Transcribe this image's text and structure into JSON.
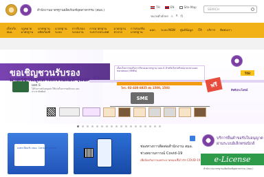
{
  "header": {
    "org_name": "สำนักงานมาตรฐานผลิตภัณฑ์อุตสาหกรรม (สมอ.)",
    "lang_th": "TH",
    "lang_en": "EN",
    "sitemap": "Site Map",
    "font_size_label": "ขนาดตัวอักษร",
    "font_normal": "ก",
    "font_large": "ก",
    "font_larger": "ก",
    "search_placeholder": "SEARCH"
  },
  "nav": {
    "items": [
      {
        "line1": "เกี่ยวกับ",
        "line2": "สมอ."
      },
      {
        "line1": "กฎหมาย",
        "line2": "มาตรฐาน"
      },
      {
        "line1": "มาตรฐาน",
        "line2": "ผลิตภัณฑ์"
      },
      {
        "line1": "มาตรฐาน",
        "line2": "ระบบ"
      },
      {
        "line1": "การรับรอง",
        "line2": "ระบบงาน"
      },
      {
        "line1": "การมาตรฐาน",
        "line2": "ระหว่างประเทศ"
      },
      {
        "line1": "มาตรฐาน",
        "line2": "ฮาลาล"
      },
      {
        "line1": "การส่งเสริม",
        "line2": "มาตรฐาน"
      },
      {
        "line1": "มอก.",
        "line2": ""
      },
      {
        "line1": "ระบบ NSW",
        "line2": ""
      },
      {
        "line1": "ศูนย์ข้อมูล",
        "line2": ""
      },
      {
        "line1": "ITA",
        "line2": ""
      },
      {
        "line1": "บริการ",
        "line2": ""
      },
      {
        "line1": "ติดต่อเรา",
        "line2": ""
      }
    ]
  },
  "banner": {
    "title": "ขอเชิญชวนรับรอง",
    "subtitle": "มาตรฐานอุตสาหกรรมเอส (มอก.S)",
    "logo_label": "มอก.S",
    "center_text": "เงื่อนไขการขอรับการรับรองมาตรฐาน มอก.S สำหรับวิสาหกิจขนาดกลางและขนาดย่อม (SMEs)",
    "phone": "โทร. 02-430 6825 ต่อ 1500, 1503",
    "sme": "SME",
    "tisi": "TISI",
    "free": "ฟรี",
    "privilege": "สิทธิประโยชน์",
    "priv_list": "ได้รับการสนับสนุนค่าใช้จ่ายในการขอรับรอง และประชาสัมพันธ์"
  },
  "news": {
    "title": "ช่องทางการติดต่อสำนักงาน สมอ.",
    "subtitle": "ช่วงสถานการณ์ Covid-19",
    "note": "เพื่อป้องกันการแพร่ระบาดของเชื้อไวรัส COVID-19"
  },
  "eservice": {
    "line1": "บริการยื่นคำขอรับใบอนุญาต",
    "line2": "ผ่านระบบอิเล็กทรอนิกส์",
    "elicense": "e-License",
    "sub": "สำนักงานมาตรฐานผลิตภัณฑ์อุตสาหกรรม (สมอ.)"
  },
  "card1": {
    "text": "ลงทะเบียนรับ สมอ. Contact Center"
  },
  "colors": {
    "nav_bg": "#f3b118",
    "brand_purple": "#5a2d91",
    "elicense_green": "#2d9b4a"
  }
}
